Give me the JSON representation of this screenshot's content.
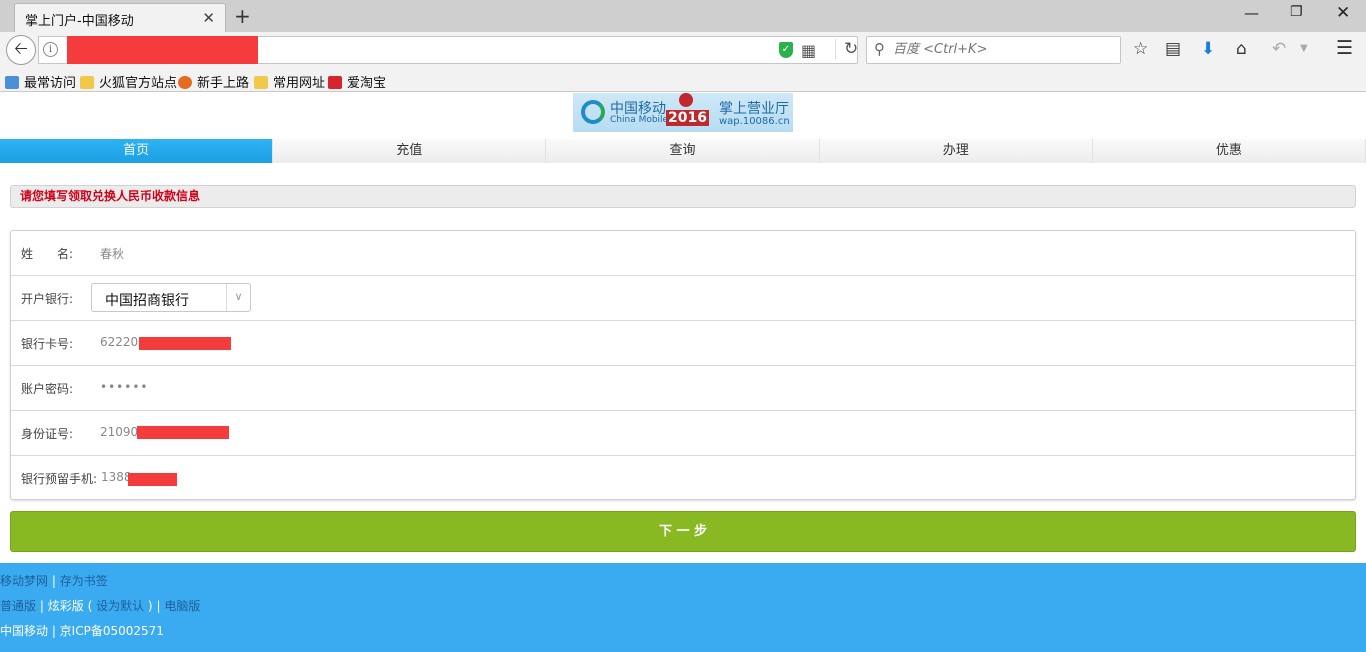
{
  "browser": {
    "tab_title": "掌上门户-中国移动",
    "tab_close": "✕",
    "new_tab": "+",
    "search_placeholder": "百度 <Ctrl+K>",
    "bookmarks": [
      "最常访问",
      "火狐官方站点",
      "新手上路",
      "常用网址",
      "爱淘宝"
    ]
  },
  "logo": {
    "brand_cn": "中国移动",
    "brand_en": "China Mobile",
    "year": "2016",
    "tagline": "掌上营业厅",
    "url": "wap.10086.cn"
  },
  "nav": [
    "首页",
    "充值",
    "查询",
    "办理",
    "优惠"
  ],
  "notice": "请您填写领取兑换人民币收款信息",
  "form": {
    "name_label": "姓　　名:",
    "name_value": "春秋",
    "bank_label": "开户银行:",
    "bank_value": "中国招商银行",
    "card_label": "银行卡号:",
    "card_value": "622202",
    "password_label": "账户密码:",
    "password_value": "••••••",
    "id_label": "身份证号:",
    "id_value": "21090",
    "phone_label": "银行预留手机:",
    "phone_value": "1388"
  },
  "next_button": "下 一 步",
  "footer": {
    "line1": [
      "移动梦网",
      "|",
      "存为书签"
    ],
    "line2": [
      "普通版",
      "|",
      "炫彩版",
      "(",
      "设为默认",
      ")",
      "|",
      "电脑版"
    ],
    "line3": "中国移动 | 京ICP备05002571"
  },
  "colors": {
    "accent": "#1d9fe3",
    "notice_text": "#d0021b",
    "button": "#88b923",
    "footer_bg": "#3aabf0"
  }
}
